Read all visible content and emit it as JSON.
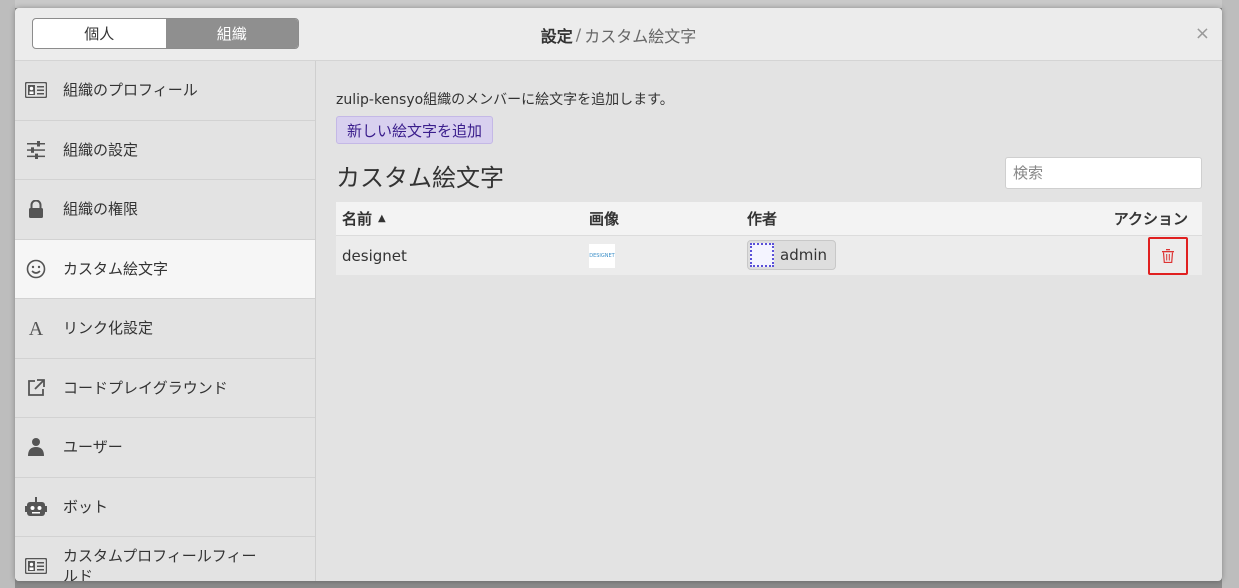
{
  "tabs": {
    "personal": "個人",
    "organization": "組織",
    "active": "organization"
  },
  "header": {
    "title_bold": "設定",
    "separator": "/",
    "title_sub": "カスタム絵文字",
    "close_symbol": "×"
  },
  "sidebar": {
    "items": [
      {
        "label": "組織のプロフィール",
        "icon": "id-card-icon"
      },
      {
        "label": "組織の設定",
        "icon": "sliders-icon"
      },
      {
        "label": "組織の権限",
        "icon": "lock-icon"
      },
      {
        "label": "カスタム絵文字",
        "icon": "smile-icon",
        "active": true
      },
      {
        "label": "リンク化設定",
        "icon": "font-a-icon"
      },
      {
        "label": "コードプレイグラウンド",
        "icon": "external-link-icon"
      },
      {
        "label": "ユーザー",
        "icon": "user-icon"
      },
      {
        "label": "ボット",
        "icon": "robot-icon"
      },
      {
        "label": "カスタムプロフィールフィールド",
        "icon": "id-card-icon"
      }
    ]
  },
  "main": {
    "intro": "zulip-kensyo組織のメンバーに絵文字を追加します。",
    "add_button": "新しい絵文字を追加",
    "section_title": "カスタム絵文字",
    "search_placeholder": "検索",
    "table": {
      "headers": {
        "name": "名前",
        "sort_indicator": "▲",
        "image": "画像",
        "author": "作者",
        "actions": "アクション"
      },
      "rows": [
        {
          "name": "designet",
          "image_text": "DESIGNET",
          "author": "admin"
        }
      ]
    }
  },
  "colors": {
    "accent_button_bg": "#d8d0ef",
    "delete_highlight": "#e02020"
  }
}
